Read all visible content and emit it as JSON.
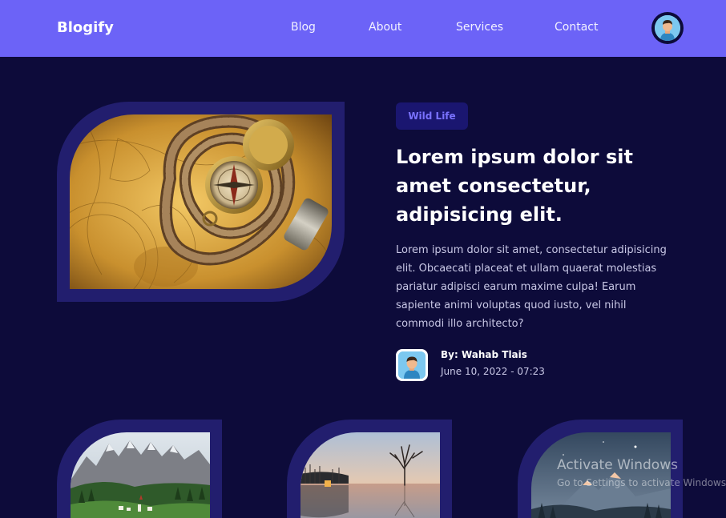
{
  "navbar": {
    "brand": "Blogify",
    "links": [
      "Blog",
      "About",
      "Services",
      "Contact"
    ]
  },
  "hero": {
    "tag": "Wild Life",
    "title": "Lorem ipsum dolor sit amet consectetur, adipisicing elit.",
    "excerpt": "Lorem ipsum dolor sit amet, consectetur adipisicing elit. Obcaecati placeat et ullam quaerat molestias pariatur adipisci earum maxime culpa! Earum sapiente animi voluptas quod iusto, vel nihil commodi illo architecto?",
    "author": "By: Wahab Tlais",
    "date": "June 10, 2022 - 07:23"
  },
  "watermark": {
    "title": "Activate Windows",
    "subtitle": "Go to Settings to activate Windows."
  },
  "colors": {
    "accent": "#6c63f7",
    "background": "#0d0b3a",
    "frame": "#221e6e",
    "tag_text": "#7a72ff"
  }
}
